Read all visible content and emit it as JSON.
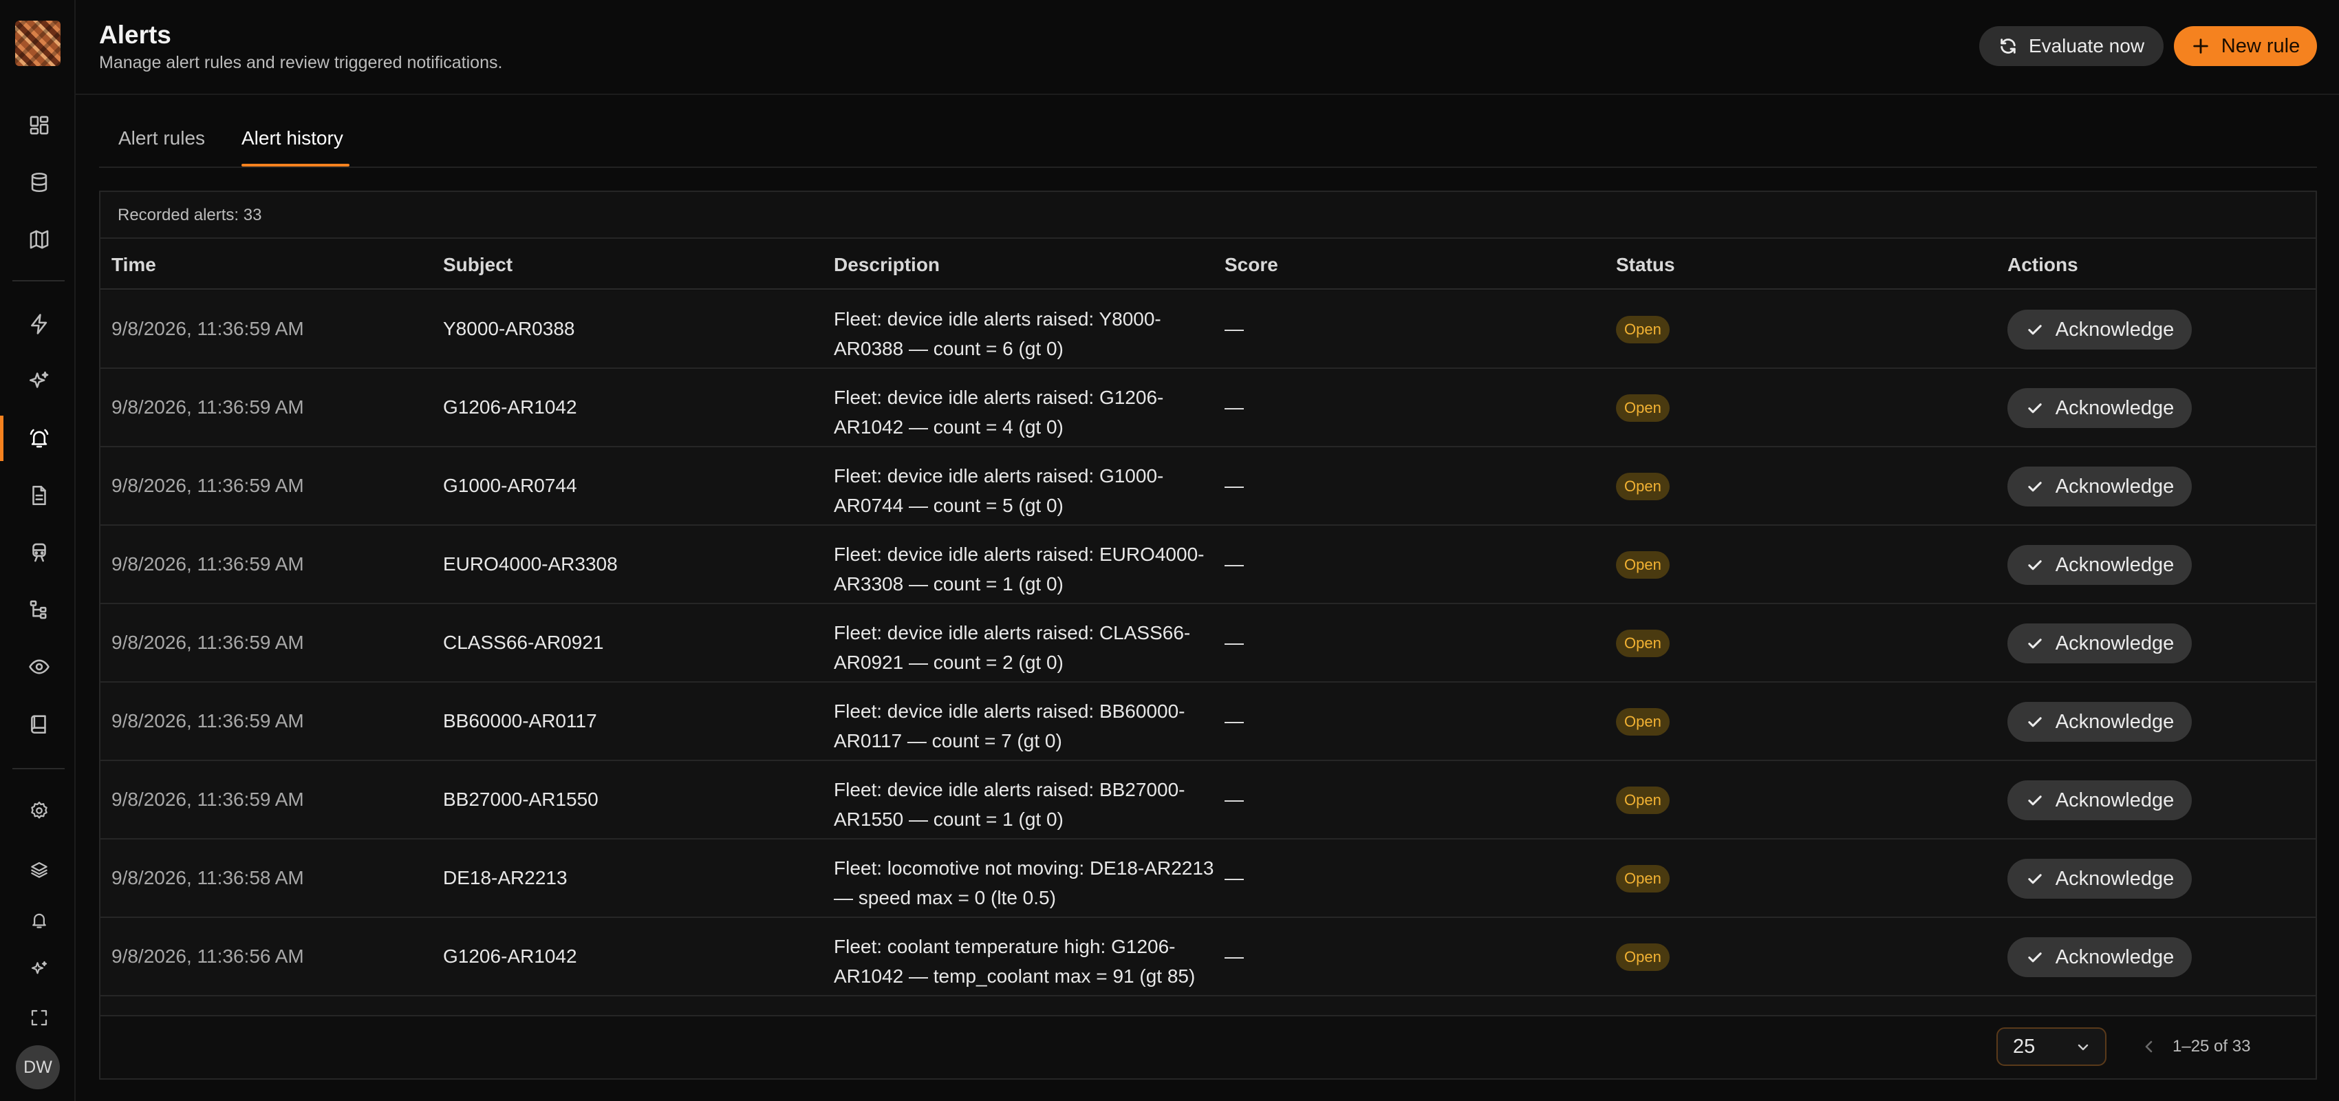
{
  "header": {
    "title": "Alerts",
    "subtitle": "Manage alert rules and review triggered notifications.",
    "evaluate_label": "Evaluate now",
    "new_rule_label": "New rule"
  },
  "tabs": [
    {
      "label": "Alert rules",
      "active": false
    },
    {
      "label": "Alert history",
      "active": true
    }
  ],
  "sidebar": {
    "icons": [
      "dashboard-icon",
      "database-icon",
      "map-icon",
      "lightning-icon",
      "sparkles-icon",
      "bell-alarm-icon",
      "document-icon",
      "locomotive-icon",
      "hierarchy-icon",
      "eye-icon",
      "report-icon",
      "settings-icon",
      "layers-icon",
      "bell-icon",
      "sparkle-small-icon",
      "fullscreen-icon"
    ],
    "active_item": "bell-alarm-icon",
    "avatar_initials": "DW"
  },
  "table": {
    "summary": "Recorded alerts: 33",
    "columns": [
      "Time",
      "Subject",
      "Description",
      "Score",
      "Status",
      "Actions"
    ],
    "action_label": "Acknowledge",
    "rows": [
      {
        "time": "9/8/2026, 11:36:59 AM",
        "subject": "Y8000-AR0388",
        "description": "Fleet: device idle alerts raised: Y8000-AR0388 — count = 6 (gt 0)",
        "score": "—",
        "status": "Open"
      },
      {
        "time": "9/8/2026, 11:36:59 AM",
        "subject": "G1206-AR1042",
        "description": "Fleet: device idle alerts raised: G1206-AR1042 — count = 4 (gt 0)",
        "score": "—",
        "status": "Open"
      },
      {
        "time": "9/8/2026, 11:36:59 AM",
        "subject": "G1000-AR0744",
        "description": "Fleet: device idle alerts raised: G1000-AR0744 — count = 5 (gt 0)",
        "score": "—",
        "status": "Open"
      },
      {
        "time": "9/8/2026, 11:36:59 AM",
        "subject": "EURO4000-AR3308",
        "description": "Fleet: device idle alerts raised: EURO4000-AR3308 — count = 1 (gt 0)",
        "score": "—",
        "status": "Open"
      },
      {
        "time": "9/8/2026, 11:36:59 AM",
        "subject": "CLASS66-AR0921",
        "description": "Fleet: device idle alerts raised: CLASS66-AR0921 — count = 2 (gt 0)",
        "score": "—",
        "status": "Open"
      },
      {
        "time": "9/8/2026, 11:36:59 AM",
        "subject": "BB60000-AR0117",
        "description": "Fleet: device idle alerts raised: BB60000-AR0117 — count = 7 (gt 0)",
        "score": "—",
        "status": "Open"
      },
      {
        "time": "9/8/2026, 11:36:59 AM",
        "subject": "BB27000-AR1550",
        "description": "Fleet: device idle alerts raised: BB27000-AR1550 — count = 1 (gt 0)",
        "score": "—",
        "status": "Open"
      },
      {
        "time": "9/8/2026, 11:36:58 AM",
        "subject": "DE18-AR2213",
        "description": "Fleet: locomotive not moving: DE18-AR2213 — speed max = 0 (lte 0.5)",
        "score": "—",
        "status": "Open"
      },
      {
        "time": "9/8/2026, 11:36:56 AM",
        "subject": "G1206-AR1042",
        "description": "Fleet: coolant temperature high: G1206-AR1042 — temp_coolant max = 91 (gt 85)",
        "score": "—",
        "status": "Open"
      },
      {
        "time": "",
        "subject": "",
        "description": "Fleet: coolant temperature high: G1206-AR1042 —",
        "score": "",
        "status": ""
      }
    ]
  },
  "pagination": {
    "page_size": "25",
    "range": "1–25 of 33"
  },
  "colors": {
    "accent": "#f5821f",
    "status_open_bg": "#4a3a10",
    "status_open_text": "#f2b233"
  }
}
